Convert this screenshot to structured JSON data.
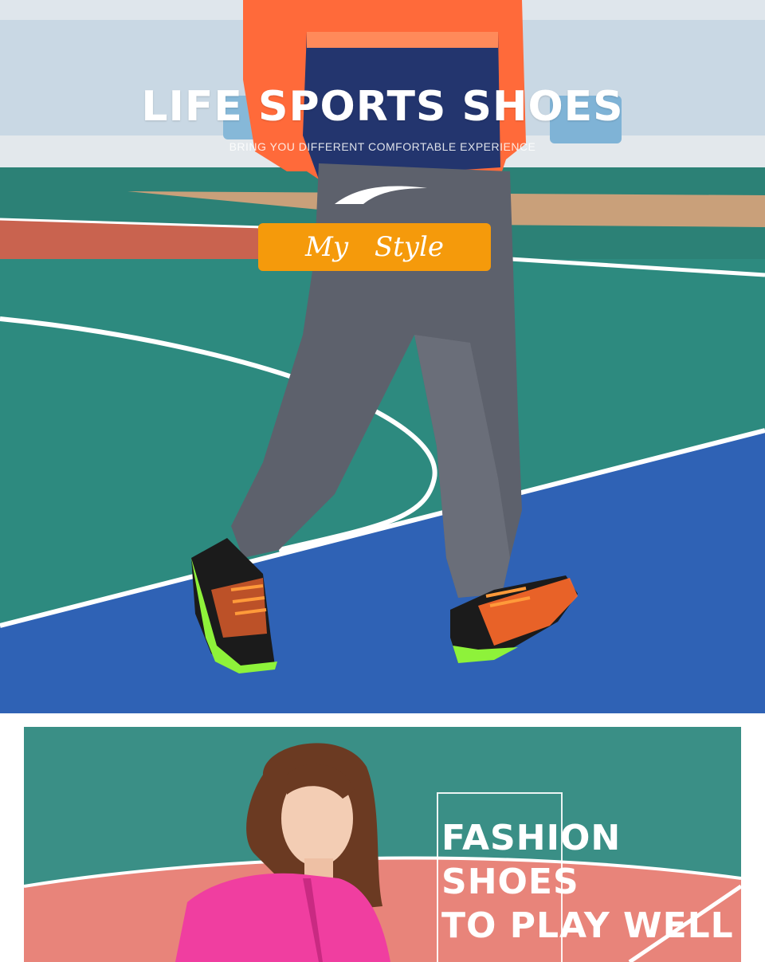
{
  "hero": {
    "title": "LIFE SPORTS SHOES",
    "subtitle": "BRING YOU DIFFERENT COMFORTABLE EXPERIENCE",
    "badge_text": "My Style",
    "colors": {
      "badge": "#f59a0b",
      "court_green": "#2d8a7f",
      "court_blue": "#2f62b5",
      "jacket_orange": "#ff6a3a",
      "jacket_navy": "#23356e",
      "pants_gray": "#5d616c"
    },
    "images": [
      "man-walking-photo",
      "brand-logo-icon",
      "running-shoe-left",
      "running-shoe-right"
    ]
  },
  "banner": {
    "lines": [
      "FASHION",
      "SHOES",
      "TO PLAY WELL"
    ],
    "colors": {
      "court_teal": "#3a8f86",
      "court_pink": "#e8847a",
      "jacket_pink": "#f03ea0"
    },
    "images": [
      "woman-portrait-photo"
    ]
  }
}
